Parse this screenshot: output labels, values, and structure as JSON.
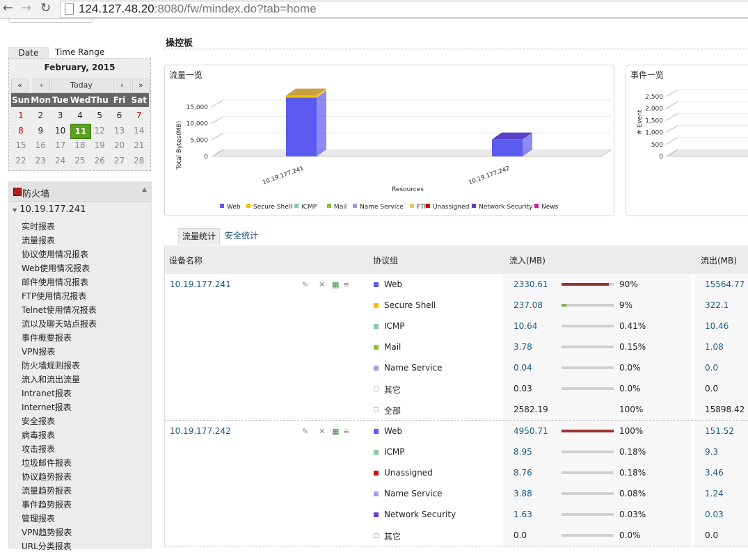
{
  "browser": {
    "url_host": "124.127.48.20",
    "url_rest": ":8080/fw/mindex.do?tab=home"
  },
  "left": {
    "tabs": [
      "Date",
      "Time Range"
    ],
    "calendar": {
      "month": "February, 2015",
      "nav": [
        "«",
        "‹",
        "Today",
        "›",
        "»"
      ],
      "days": [
        "Sun",
        "Mon",
        "Tue",
        "Wed",
        "Thu",
        "Fri",
        "Sat"
      ],
      "weeks": [
        [
          "1",
          "2",
          "3",
          "4",
          "5",
          "6",
          "7"
        ],
        [
          "8",
          "9",
          "10",
          "11",
          "12",
          "13",
          "14"
        ],
        [
          "15",
          "16",
          "17",
          "18",
          "19",
          "20",
          "21"
        ],
        [
          "22",
          "23",
          "24",
          "25",
          "26",
          "27",
          "28"
        ]
      ],
      "today": "11"
    },
    "panel_title": "防火墙",
    "device": "10.19.177.241",
    "reports": [
      "实时报表",
      "流量报表",
      "协议使用情况报表",
      "Web使用情况报表",
      "邮件使用情况报表",
      "FTP使用情况报表",
      "Telnet使用情况报表",
      "流以及聊天站点报表",
      "事件概要报表",
      "VPN报表",
      "防火墙规则报表",
      "流入和流出流量",
      "Intranet报表",
      "Internet报表",
      "安全报表",
      "病毒报表",
      "攻击报表",
      "垃圾邮件报表",
      "协议趋势报表",
      "流量趋势报表",
      "事件趋势报表",
      "管理报表",
      "VPN趋势报表",
      "URL分类报表"
    ]
  },
  "main": {
    "title": "操控板",
    "traffic_panel_title": "流量一览",
    "event_panel_title": "事件一览",
    "stat_tabs": [
      "流量统计",
      "安全统计"
    ],
    "columns": [
      "设备名称",
      "协议组",
      "流入(MB)",
      "流出(MB)"
    ]
  },
  "chart_data": [
    {
      "type": "bar",
      "title": "流量一览",
      "xlabel": "Resources",
      "ylabel": "Total Bytes(MB)",
      "ylim": [
        0,
        15000
      ],
      "yticks": [
        "0",
        "5,000",
        "10,000",
        "15,000"
      ],
      "categories": [
        "10.19.177.241",
        "10.19.177.242"
      ],
      "series": [
        {
          "name": "Web",
          "color": "#5b5bf0",
          "values": [
            17895,
            5102
          ]
        },
        {
          "name": "Secure Shell",
          "color": "#f2c200",
          "values": [
            559,
            0
          ]
        },
        {
          "name": "ICMP",
          "color": "#8cc8a0",
          "values": [
            21,
            18
          ]
        },
        {
          "name": "Mail",
          "color": "#8cc030",
          "values": [
            5,
            0
          ]
        },
        {
          "name": "Name Service",
          "color": "#a59ae8",
          "values": [
            0,
            5
          ]
        },
        {
          "name": "FTP",
          "color": "#f5c060",
          "values": [
            0,
            0
          ]
        },
        {
          "name": "Unassigned",
          "color": "#cc1010",
          "values": [
            0,
            12
          ]
        },
        {
          "name": "Network Security",
          "color": "#6a3cc8",
          "values": [
            0,
            2
          ]
        },
        {
          "name": "News",
          "color": "#d02090",
          "values": [
            0,
            0
          ]
        }
      ]
    },
    {
      "type": "line",
      "title": "事件一览",
      "ylabel": "# Event",
      "yticks": [
        "0",
        "500",
        "1,000",
        "1,500",
        "2,000",
        "2,500"
      ],
      "ylim": [
        0,
        2500
      ]
    }
  ],
  "table": [
    {
      "device": "10.19.177.241",
      "rows": [
        {
          "proto": "Web",
          "color": "#5b5bf0",
          "in": "2330.61",
          "pct": "90%",
          "frac": 0.9,
          "bar": "#a03030",
          "out": "15564.77",
          "link": true
        },
        {
          "proto": "Secure Shell",
          "color": "#f2c200",
          "in": "237.08",
          "pct": "9%",
          "frac": 0.09,
          "bar": "#7cb342",
          "out": "322.1",
          "link": true
        },
        {
          "proto": "ICMP",
          "color": "#8cc8a0",
          "in": "10.64",
          "pct": "0.41%",
          "frac": 0.0,
          "bar": "#7cb342",
          "out": "10.46",
          "link": true
        },
        {
          "proto": "Mail",
          "color": "#8cc030",
          "in": "3.78",
          "pct": "0.15%",
          "frac": 0.0,
          "bar": "#7cb342",
          "out": "1.08",
          "link": true
        },
        {
          "proto": "Name Service",
          "color": "#a59ae8",
          "in": "0.04",
          "pct": "0.0%",
          "frac": 0.0,
          "bar": "#7cb342",
          "out": "0.0",
          "link": true
        },
        {
          "proto": "其它",
          "color": "#ffffff",
          "in": "0.03",
          "pct": "0.0%",
          "frac": 0.0,
          "bar": "#7cb342",
          "out": "0.0",
          "link": false
        },
        {
          "proto": "全部",
          "color": "#ffffff",
          "in": "2582.19",
          "pct": "100%",
          "frac": -1,
          "bar": "",
          "out": "15898.42",
          "link": false
        }
      ]
    },
    {
      "device": "10.19.177.242",
      "rows": [
        {
          "proto": "Web",
          "color": "#5b5bf0",
          "in": "4950.71",
          "pct": "100%",
          "frac": 1.0,
          "bar": "#a03030",
          "out": "151.52",
          "link": true
        },
        {
          "proto": "ICMP",
          "color": "#8cc8a0",
          "in": "8.95",
          "pct": "0.18%",
          "frac": 0.0,
          "bar": "#7cb342",
          "out": "9.3",
          "link": true
        },
        {
          "proto": "Unassigned",
          "color": "#cc1010",
          "in": "8.76",
          "pct": "0.18%",
          "frac": 0.0,
          "bar": "#7cb342",
          "out": "3.46",
          "link": true
        },
        {
          "proto": "Name Service",
          "color": "#a59ae8",
          "in": "3.88",
          "pct": "0.08%",
          "frac": 0.0,
          "bar": "#7cb342",
          "out": "1.24",
          "link": true
        },
        {
          "proto": "Network Security",
          "color": "#6a3cc8",
          "in": "1.63",
          "pct": "0.03%",
          "frac": 0.0,
          "bar": "#7cb342",
          "out": "0.03",
          "link": true
        },
        {
          "proto": "其它",
          "color": "#ffffff",
          "in": "0.0",
          "pct": "0.0%",
          "frac": 0.0,
          "bar": "#7cb342",
          "out": "0.0",
          "link": false
        }
      ]
    }
  ]
}
